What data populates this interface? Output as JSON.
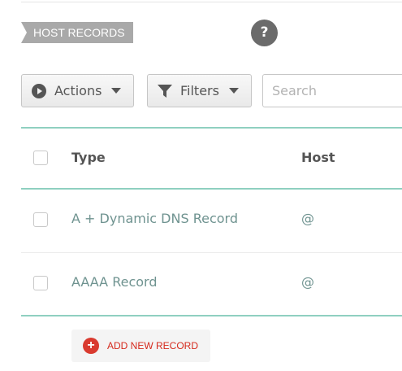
{
  "section": {
    "title": "HOST RECORDS",
    "help_icon": "?"
  },
  "toolbar": {
    "actions_label": "Actions",
    "actions_icon": "play-circle-icon",
    "filters_label": "Filters",
    "filters_icon": "funnel-icon",
    "search_placeholder": "Search",
    "search_value": ""
  },
  "table": {
    "columns": [
      "Type",
      "Host"
    ],
    "rows": [
      {
        "type": "A + Dynamic DNS Record",
        "host": "@",
        "checked": false
      },
      {
        "type": "AAAA Record",
        "host": "@",
        "checked": false
      }
    ]
  },
  "add_record": {
    "label": "ADD NEW RECORD",
    "icon": "plus-circle-icon"
  },
  "colors": {
    "accent_rule": "#8fd0c0",
    "link_text": "#6f9390",
    "add_red": "#d52a1d",
    "tag_gray": "#a9a9a9"
  }
}
